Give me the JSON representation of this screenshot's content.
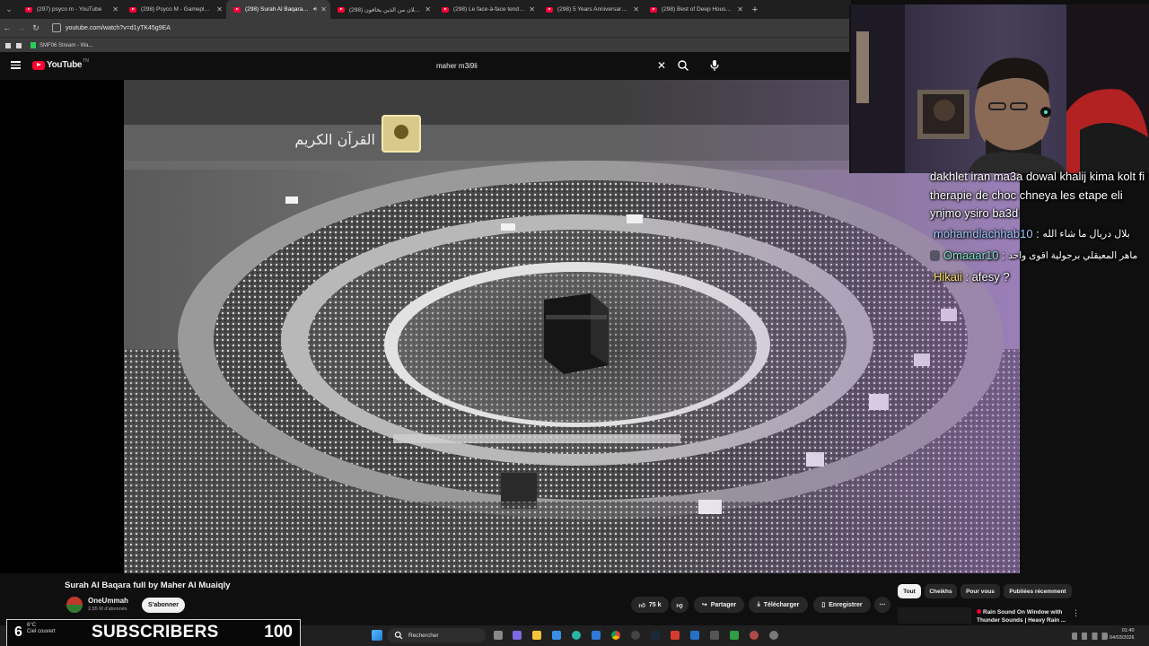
{
  "browser": {
    "tabs": [
      {
        "label": "(297) psyco m - YouTube",
        "active": false
      },
      {
        "label": "(298) Psyco M - Gameplay Strategie",
        "active": false
      },
      {
        "label": "(298) Surah Al Baqara full b",
        "active": true
      },
      {
        "label": "(298) قال رجلان من الذين يخافون",
        "active": false
      },
      {
        "label": "(298) Le face-à-face tendu entre",
        "active": false
      },
      {
        "label": "(298) 5 Years Anniversary Special",
        "active": false
      },
      {
        "label": "(298) Best of Deep House [2024]",
        "active": false
      }
    ],
    "url": "youtube.com/watch?v=d1yTK45g9EA",
    "bookmarks": [
      {
        "label": "SMF06 Stream - Wa..."
      }
    ]
  },
  "youtube": {
    "logo": "YouTube",
    "logo_sup": "TN",
    "search_value": "maher m3i9li"
  },
  "video": {
    "overlay_text": "القرآن الكريم",
    "title": "Surah Al Baqara full by Maher Al Muaiqly",
    "channel": "OneUmmah",
    "subscribers": "2,55 M d'abonnés",
    "subscribe_label": "S'abonner",
    "likes": "75 k",
    "share_label": "Partager",
    "download_label": "Télécharger",
    "save_label": "Enregistrer"
  },
  "chat": {
    "intro": "dakhlet iran ma3a dowal khalij kima kolt fi therapie de choc chneya les etape eli ynjmo ysiro ba3d",
    "messages": [
      {
        "user": "mohamdlachhab10",
        "text": "بلال دريال ما شاء الله"
      },
      {
        "user": "Omaaar10",
        "text": "ماهر المعيقلي برجولية اقوى واحد"
      },
      {
        "user": "Hikaii",
        "text": "afesy ?"
      }
    ]
  },
  "sidebar": {
    "chips": [
      "Tout",
      "Cheikhs",
      "Pour vous",
      "Publiées récemment"
    ],
    "rec_title": "Rain Sound On Window with Thunder Sounds | Heavy Rain ..."
  },
  "overlay": {
    "prefix": "6",
    "label": "SUBSCRIBERS",
    "count": "100"
  },
  "taskbar": {
    "weather_temp": "6°C",
    "weather_desc": "Ciel couvert",
    "search_placeholder": "Rechercher",
    "time": "01:40",
    "date": "04/03/2026"
  }
}
